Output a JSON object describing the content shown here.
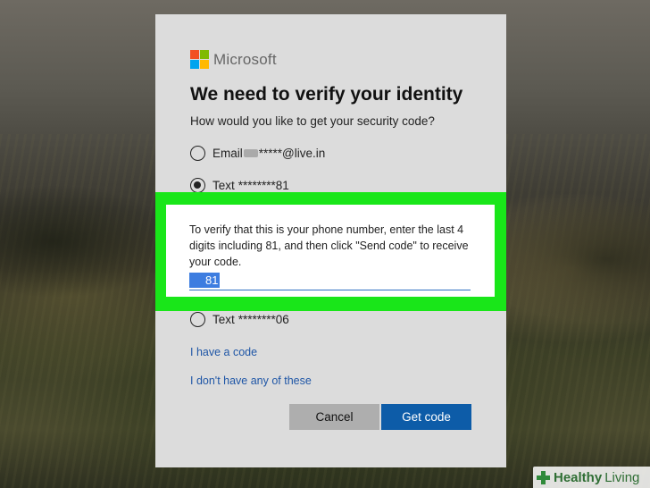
{
  "dialog": {
    "brand": "Microsoft",
    "brand_colors": [
      "#f25022",
      "#7fba00",
      "#00a4ef",
      "#ffb900"
    ],
    "title": "We need to verify your identity",
    "subtitle": "How would you like to get your security code?",
    "options": [
      {
        "prefix": "Email",
        "value": "*****@live.in",
        "selected": false
      },
      {
        "prefix": "Text",
        "value": "********81",
        "selected": true
      },
      {
        "prefix": "Text",
        "value": "********06",
        "selected": false
      }
    ],
    "verify_text": "To verify that this is your phone number, enter the last 4 digits including 81, and then click \"Send code\" to receive your code.",
    "code_input_value": "81",
    "links": {
      "have_code": "I have a code",
      "no_options": "I don't have any of these"
    },
    "buttons": {
      "cancel": "Cancel",
      "get_code": "Get code"
    }
  },
  "colors": {
    "highlight": "#19e619",
    "primary_button": "#0d5ca8",
    "link": "#1f56a6"
  },
  "watermark": {
    "part1": "Healthy",
    "part2": "Living"
  }
}
